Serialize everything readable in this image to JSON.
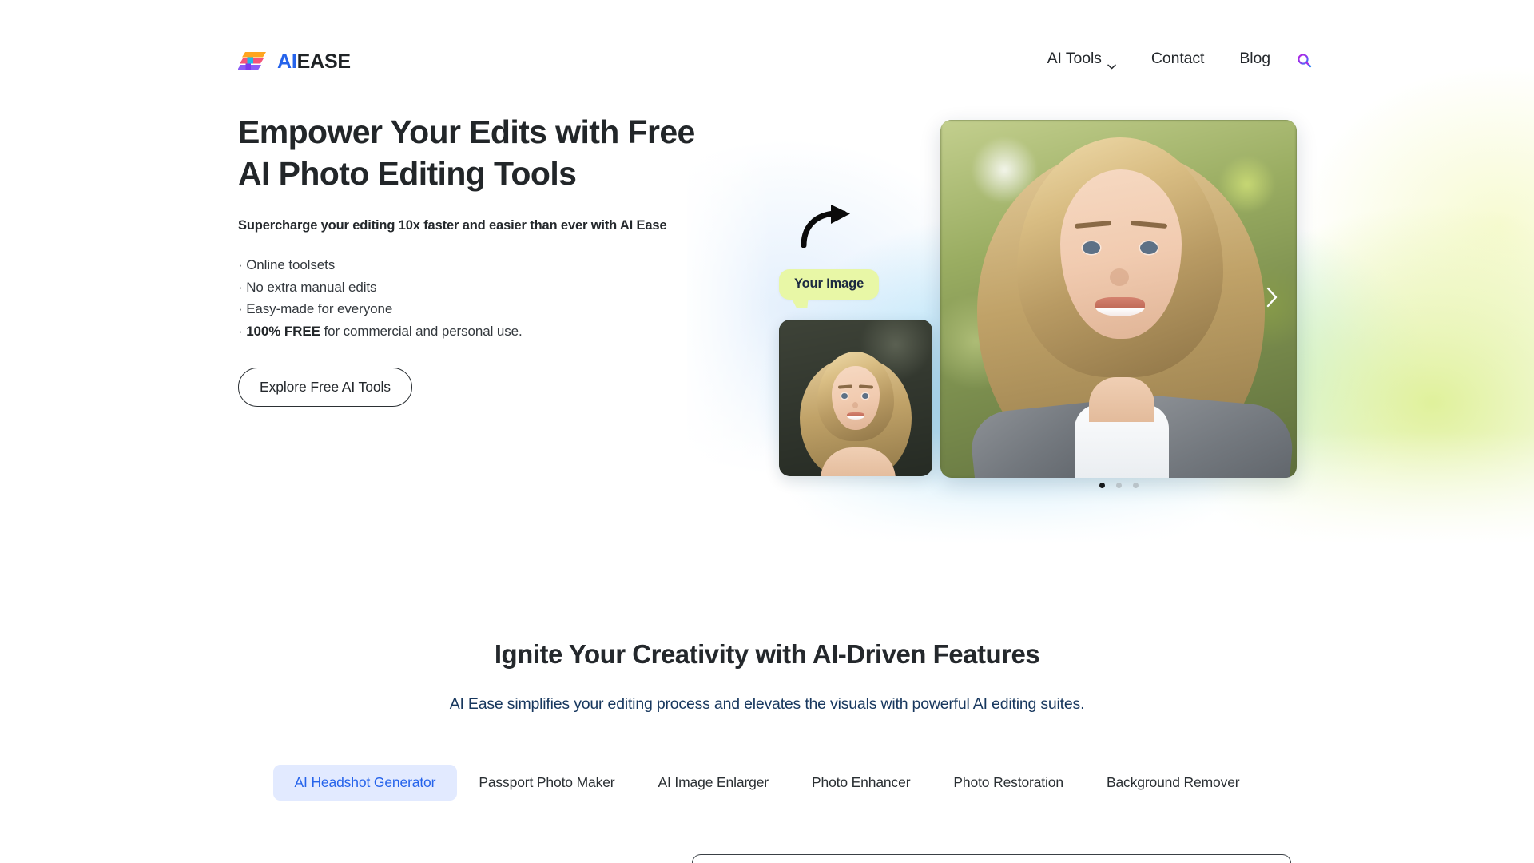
{
  "brand": {
    "logo_ai": "AI",
    "logo_ease": "EASE",
    "logo_mark_icon": "aiease-logo-icon"
  },
  "header": {
    "nav": [
      {
        "label": "AI Tools",
        "has_dropdown": true,
        "icon": "chevron-down-icon"
      },
      {
        "label": "Contact",
        "has_dropdown": false
      },
      {
        "label": "Blog",
        "has_dropdown": false
      }
    ],
    "search_icon": "search-icon"
  },
  "hero": {
    "title_line1": "Empower Your Edits with Free",
    "title_line2": "AI Photo Editing Tools",
    "subtitle": "Supercharge your editing 10x faster and easier than ever with AI Ease",
    "bullets": [
      {
        "prefix": "· ",
        "text": "Online toolsets",
        "bold": ""
      },
      {
        "prefix": "· ",
        "text": "No extra manual edits",
        "bold": ""
      },
      {
        "prefix": "· ",
        "text": "Easy-made for everyone",
        "bold": ""
      },
      {
        "prefix": "· ",
        "bold": "100% FREE",
        "text": " for commercial and personal use."
      }
    ],
    "cta_label": "Explore Free AI Tools",
    "badge_label": "Your Image",
    "arrow_icon": "curved-arrow-right-icon",
    "next_icon": "chevron-right-icon",
    "dots": [
      {
        "active": true
      },
      {
        "active": false
      },
      {
        "active": false
      }
    ]
  },
  "features": {
    "title": "Ignite Your Creativity with AI-Driven Features",
    "subtitle": "AI Ease simplifies your editing process and elevates the visuals with powerful AI editing suites.",
    "tabs": [
      {
        "label": "AI Headshot Generator",
        "active": true
      },
      {
        "label": "Passport Photo Maker",
        "active": false
      },
      {
        "label": "AI Image Enlarger",
        "active": false
      },
      {
        "label": "Photo Enhancer",
        "active": false
      },
      {
        "label": "Photo Restoration",
        "active": false
      },
      {
        "label": "Background Remover",
        "active": false
      }
    ]
  },
  "colors": {
    "accent_blue": "#2563EB",
    "tab_active_bg": "#E2EAFF",
    "badge_bg": "#E8F7A6",
    "badge_text": "#1B2940",
    "text_dark": "#24282C",
    "subtitle_navy": "#17375E",
    "logo_orange": "#FFA51F",
    "logo_pink": "#F4547A",
    "logo_purple": "#8B5CF6",
    "logo_cyan": "#22B8E6"
  }
}
